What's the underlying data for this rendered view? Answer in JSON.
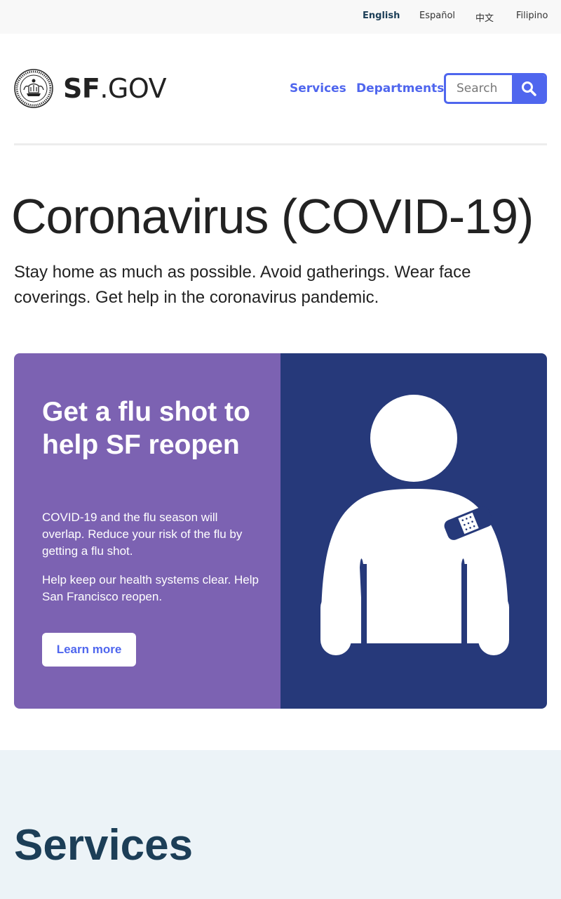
{
  "languages": [
    {
      "label": "English",
      "active": true
    },
    {
      "label": "Español",
      "active": false
    },
    {
      "label": "中文",
      "active": false
    },
    {
      "label": "Filipino",
      "active": false
    }
  ],
  "header": {
    "logo_icon": "city-seal-icon",
    "wordmark_bold": "SF",
    "wordmark_light": ".GOV",
    "nav": [
      {
        "label": "Services"
      },
      {
        "label": "Departments"
      }
    ],
    "search": {
      "placeholder": "Search",
      "value": "",
      "icon": "search-icon"
    }
  },
  "page": {
    "title": "Coronavirus (COVID-19)",
    "lede": "Stay home as much as possible. Avoid gatherings. Wear face coverings. Get help in the coronavirus pandemic."
  },
  "feature": {
    "heading": "Get a flu shot to help SF reopen",
    "paragraphs": [
      "COVID-19 and the flu season will overlap. Reduce your risk of the flu by getting a flu shot.",
      "Help keep our health systems clear. Help San Francisco reopen."
    ],
    "button_label": "Learn more",
    "illustration": "person-with-bandage-icon"
  },
  "services": {
    "title": "Services"
  },
  "colors": {
    "accent": "#4f66ee",
    "feature_purple": "#7c62b2",
    "feature_navy": "#26397a",
    "heading_navy": "#1c3e57",
    "services_bg": "#ecf3f7"
  }
}
